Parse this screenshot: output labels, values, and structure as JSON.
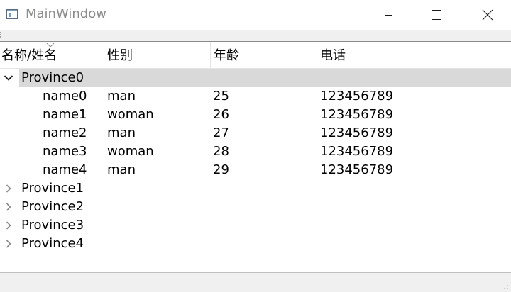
{
  "window": {
    "title": "MainWindow"
  },
  "tree": {
    "headers": [
      "名称/姓名",
      "性别",
      "年龄",
      "电话"
    ],
    "groups": [
      {
        "label": "Province0",
        "expanded": true,
        "selected": true,
        "children": [
          {
            "name": "name0",
            "gender": "man",
            "age": "25",
            "phone": "123456789"
          },
          {
            "name": "name1",
            "gender": "woman",
            "age": "26",
            "phone": "123456789"
          },
          {
            "name": "name2",
            "gender": "man",
            "age": "27",
            "phone": "123456789"
          },
          {
            "name": "name3",
            "gender": "woman",
            "age": "28",
            "phone": "123456789"
          },
          {
            "name": "name4",
            "gender": "man",
            "age": "29",
            "phone": "123456789"
          }
        ]
      },
      {
        "label": "Province1",
        "expanded": false
      },
      {
        "label": "Province2",
        "expanded": false
      },
      {
        "label": "Province3",
        "expanded": false
      },
      {
        "label": "Province4",
        "expanded": false
      }
    ]
  },
  "colors": {
    "selection": "#d9d9d9",
    "title_inactive": "#8c8c8c",
    "chrome": "#f0f0f0"
  },
  "icons": {
    "app": "window-app-icon",
    "expanded": "chevron-down-icon",
    "collapsed": "chevron-right-icon",
    "sort": "sort-indicator-icon"
  }
}
